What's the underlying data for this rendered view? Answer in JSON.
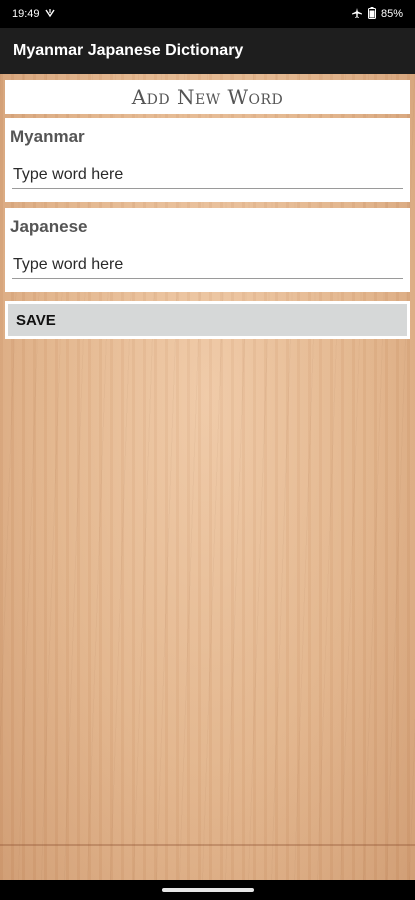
{
  "status": {
    "time": "19:49",
    "battery": "85%"
  },
  "app": {
    "title": "Myanmar Japanese Dictionary"
  },
  "form": {
    "heading": "Add New Word",
    "myanmar": {
      "label": "Myanmar",
      "placeholder": "Type word here",
      "value": ""
    },
    "japanese": {
      "label": "Japanese",
      "placeholder": "Type word here",
      "value": ""
    },
    "save_label": "SAVE"
  },
  "icons": {
    "status_left": [
      "vibrate-icon"
    ],
    "status_right": [
      "airplane-mode-icon",
      "battery-icon"
    ]
  },
  "colors": {
    "appbar": "#1e1e1e",
    "save_button": "#d6d8d8"
  }
}
